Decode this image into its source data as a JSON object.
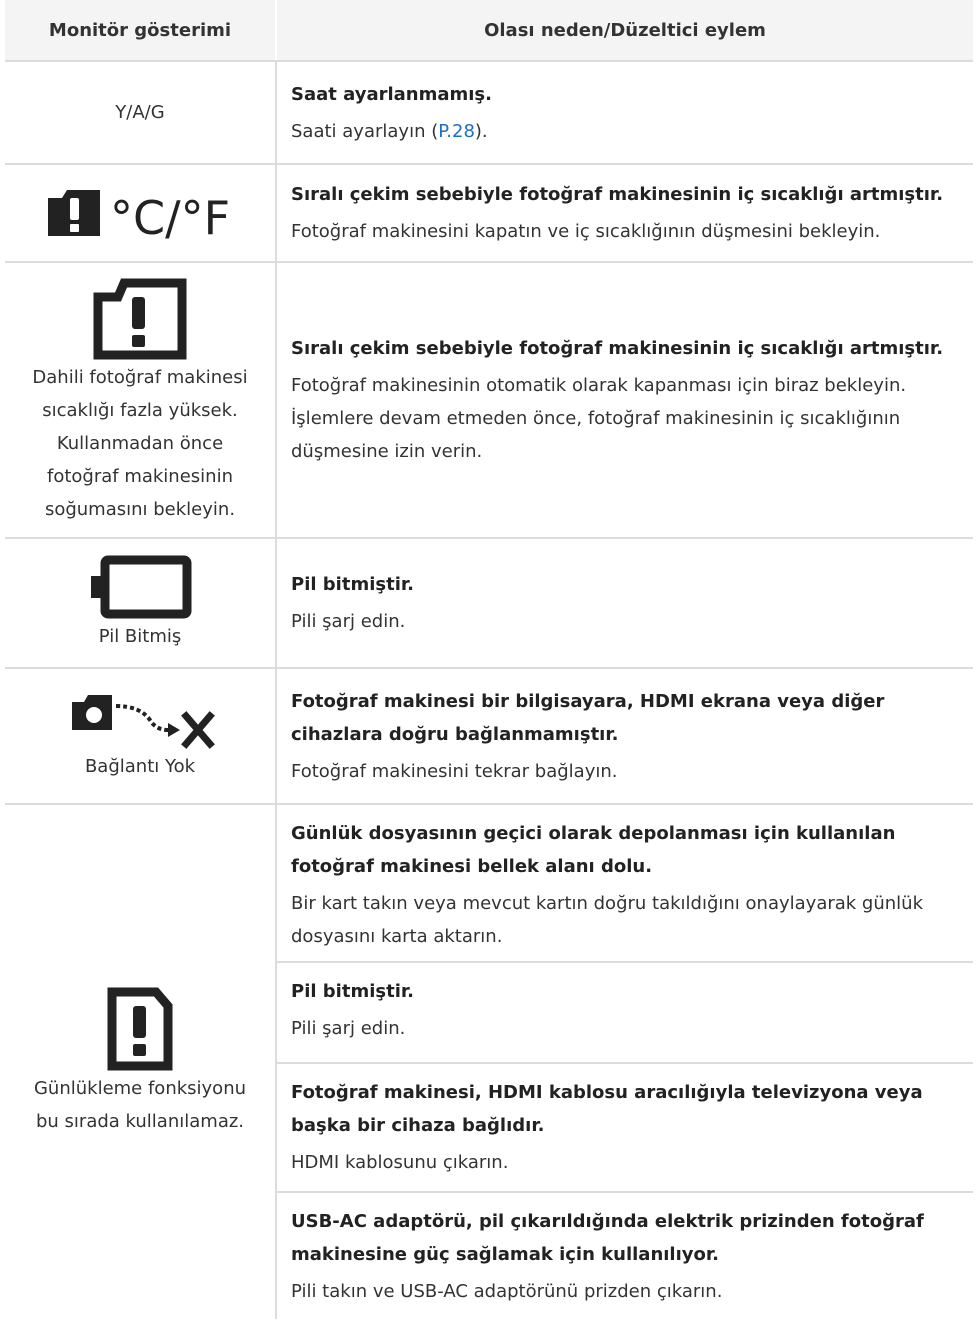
{
  "header": {
    "col1": "Monitör gösterimi",
    "col2": "Olası neden/Düzeltici eylem"
  },
  "rows": [
    {
      "display": "Y/A/G",
      "title": "Saat ayarlanmamış.",
      "action_pre": "Saati ayarlayın (",
      "action_link": "P.28",
      "action_post": ")."
    },
    {
      "icon": "camera-warning-temperature-icon",
      "icon_text": "°C/°F",
      "title": "Sıralı çekim sebebiyle fotoğraf makinesinin iç sıcaklığı artmıştır.",
      "action": "Fotoğraf makinesini kapatın ve iç sıcaklığının düşmesini bekleyin."
    },
    {
      "icon": "camera-warning-icon",
      "display_lines": [
        "Dahili fotoğraf makinesi",
        "sıcaklığı fazla yüksek.",
        "Kullanmadan önce",
        "fotoğraf makinesinin",
        "soğumasını bekleyin."
      ],
      "title": "Sıralı çekim sebebiyle fotoğraf makinesinin iç sıcaklığı artmıştır.",
      "action_lines": [
        "Fotoğraf makinesinin otomatik olarak kapanması için biraz bekleyin.",
        "İşlemlere devam etmeden önce, fotoğraf makinesinin iç sıcaklığının",
        "düşmesine izin verin."
      ]
    },
    {
      "icon": "battery-empty-icon",
      "display": "Pil Bitmiş",
      "title": "Pil bitmiştir.",
      "action": "Pili şarj edin."
    },
    {
      "icon": "camera-no-connection-icon",
      "display": "Bağlantı Yok",
      "title_lines": [
        "Fotoğraf makinesi bir bilgisayara, HDMI ekrana veya diğer",
        "cihazlara doğru bağlanmamıştır."
      ],
      "action": "Fotoğraf makinesini tekrar bağlayın."
    },
    {
      "icon": "log-warning-icon",
      "display_lines": [
        "Günlükleme fonksiyonu",
        "bu sırada kullanılamaz."
      ],
      "causes": [
        {
          "title_lines": [
            "Günlük dosyasının geçici olarak depolanması için kullanılan",
            "fotoğraf makinesi bellek alanı dolu."
          ],
          "action_lines": [
            "Bir kart takın veya mevcut kartın doğru takıldığını onaylayarak günlük",
            "dosyasını karta aktarın."
          ]
        },
        {
          "title_lines": [
            "Pil bitmiştir."
          ],
          "action_lines": [
            "Pili şarj edin."
          ]
        },
        {
          "title_lines": [
            "Fotoğraf makinesi, HDMI kablosu aracılığıyla televizyona veya",
            "başka bir cihaza bağlıdır."
          ],
          "action_lines": [
            "HDMI kablosunu çıkarın."
          ]
        },
        {
          "title_lines": [
            "USB-AC adaptörü, pil çıkarıldığında elektrik prizinden fotoğraf",
            "makinesine güç sağlamak için kullanılıyor."
          ],
          "action_lines": [
            "Pili takın ve USB-AC adaptörünü prizden çıkarın."
          ]
        }
      ]
    }
  ]
}
